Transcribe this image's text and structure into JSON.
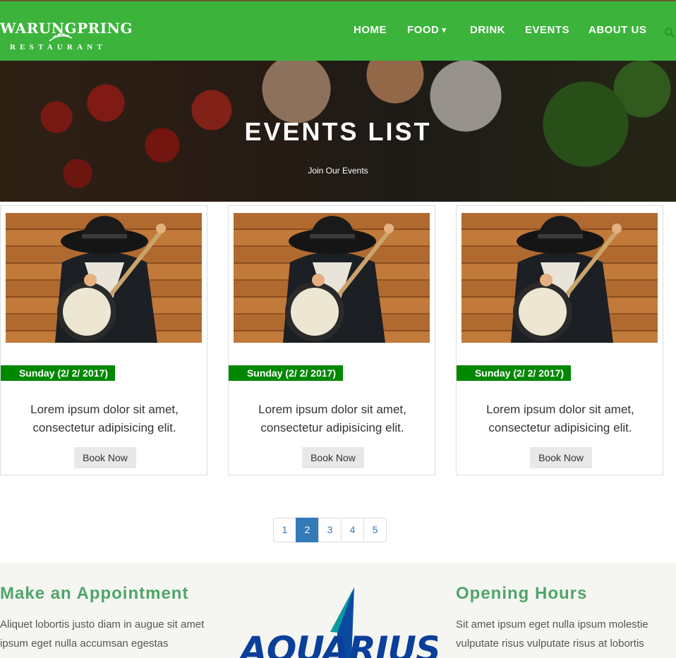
{
  "brand": {
    "name": "WARUNGPRING",
    "tagline": "RESTAURANT",
    "primary_color": "#3cb43c"
  },
  "nav": {
    "items": [
      {
        "label": "HOME"
      },
      {
        "label": "FOOD",
        "has_dropdown": true,
        "caret": "▾"
      },
      {
        "label": "DRINK"
      },
      {
        "label": "EVENTS"
      },
      {
        "label": "ABOUT US"
      }
    ],
    "search_icon": "search-icon"
  },
  "hero": {
    "title": "EVENTS LIST",
    "subtitle": "Join Our Events"
  },
  "events": [
    {
      "date": "Sunday (2/ 2/ 2017)",
      "description": "Lorem ipsum dolor sit amet, consectetur adipisicing elit.",
      "button": "Book Now"
    },
    {
      "date": "Sunday (2/ 2/ 2017)",
      "description": "Lorem ipsum dolor sit amet, consectetur adipisicing elit.",
      "button": "Book Now"
    },
    {
      "date": "Sunday (2/ 2/ 2017)",
      "description": "Lorem ipsum dolor sit amet, consectetur adipisicing elit.",
      "button": "Book Now"
    }
  ],
  "pagination": {
    "pages": [
      "1",
      "2",
      "3",
      "4",
      "5"
    ],
    "current": "2"
  },
  "footer": {
    "appointment": {
      "title": "Make an Appointment",
      "text": "Aliquet lobortis justo diam in augue sit amet ipsum eget nulla accumsan egestas"
    },
    "opening": {
      "title": "Opening Hours",
      "text": "Sit amet ipsum eget nulla ipsum molestie vulputate risus vulputate risus at lobortis"
    },
    "partner_logo": "AQUARIUS"
  }
}
